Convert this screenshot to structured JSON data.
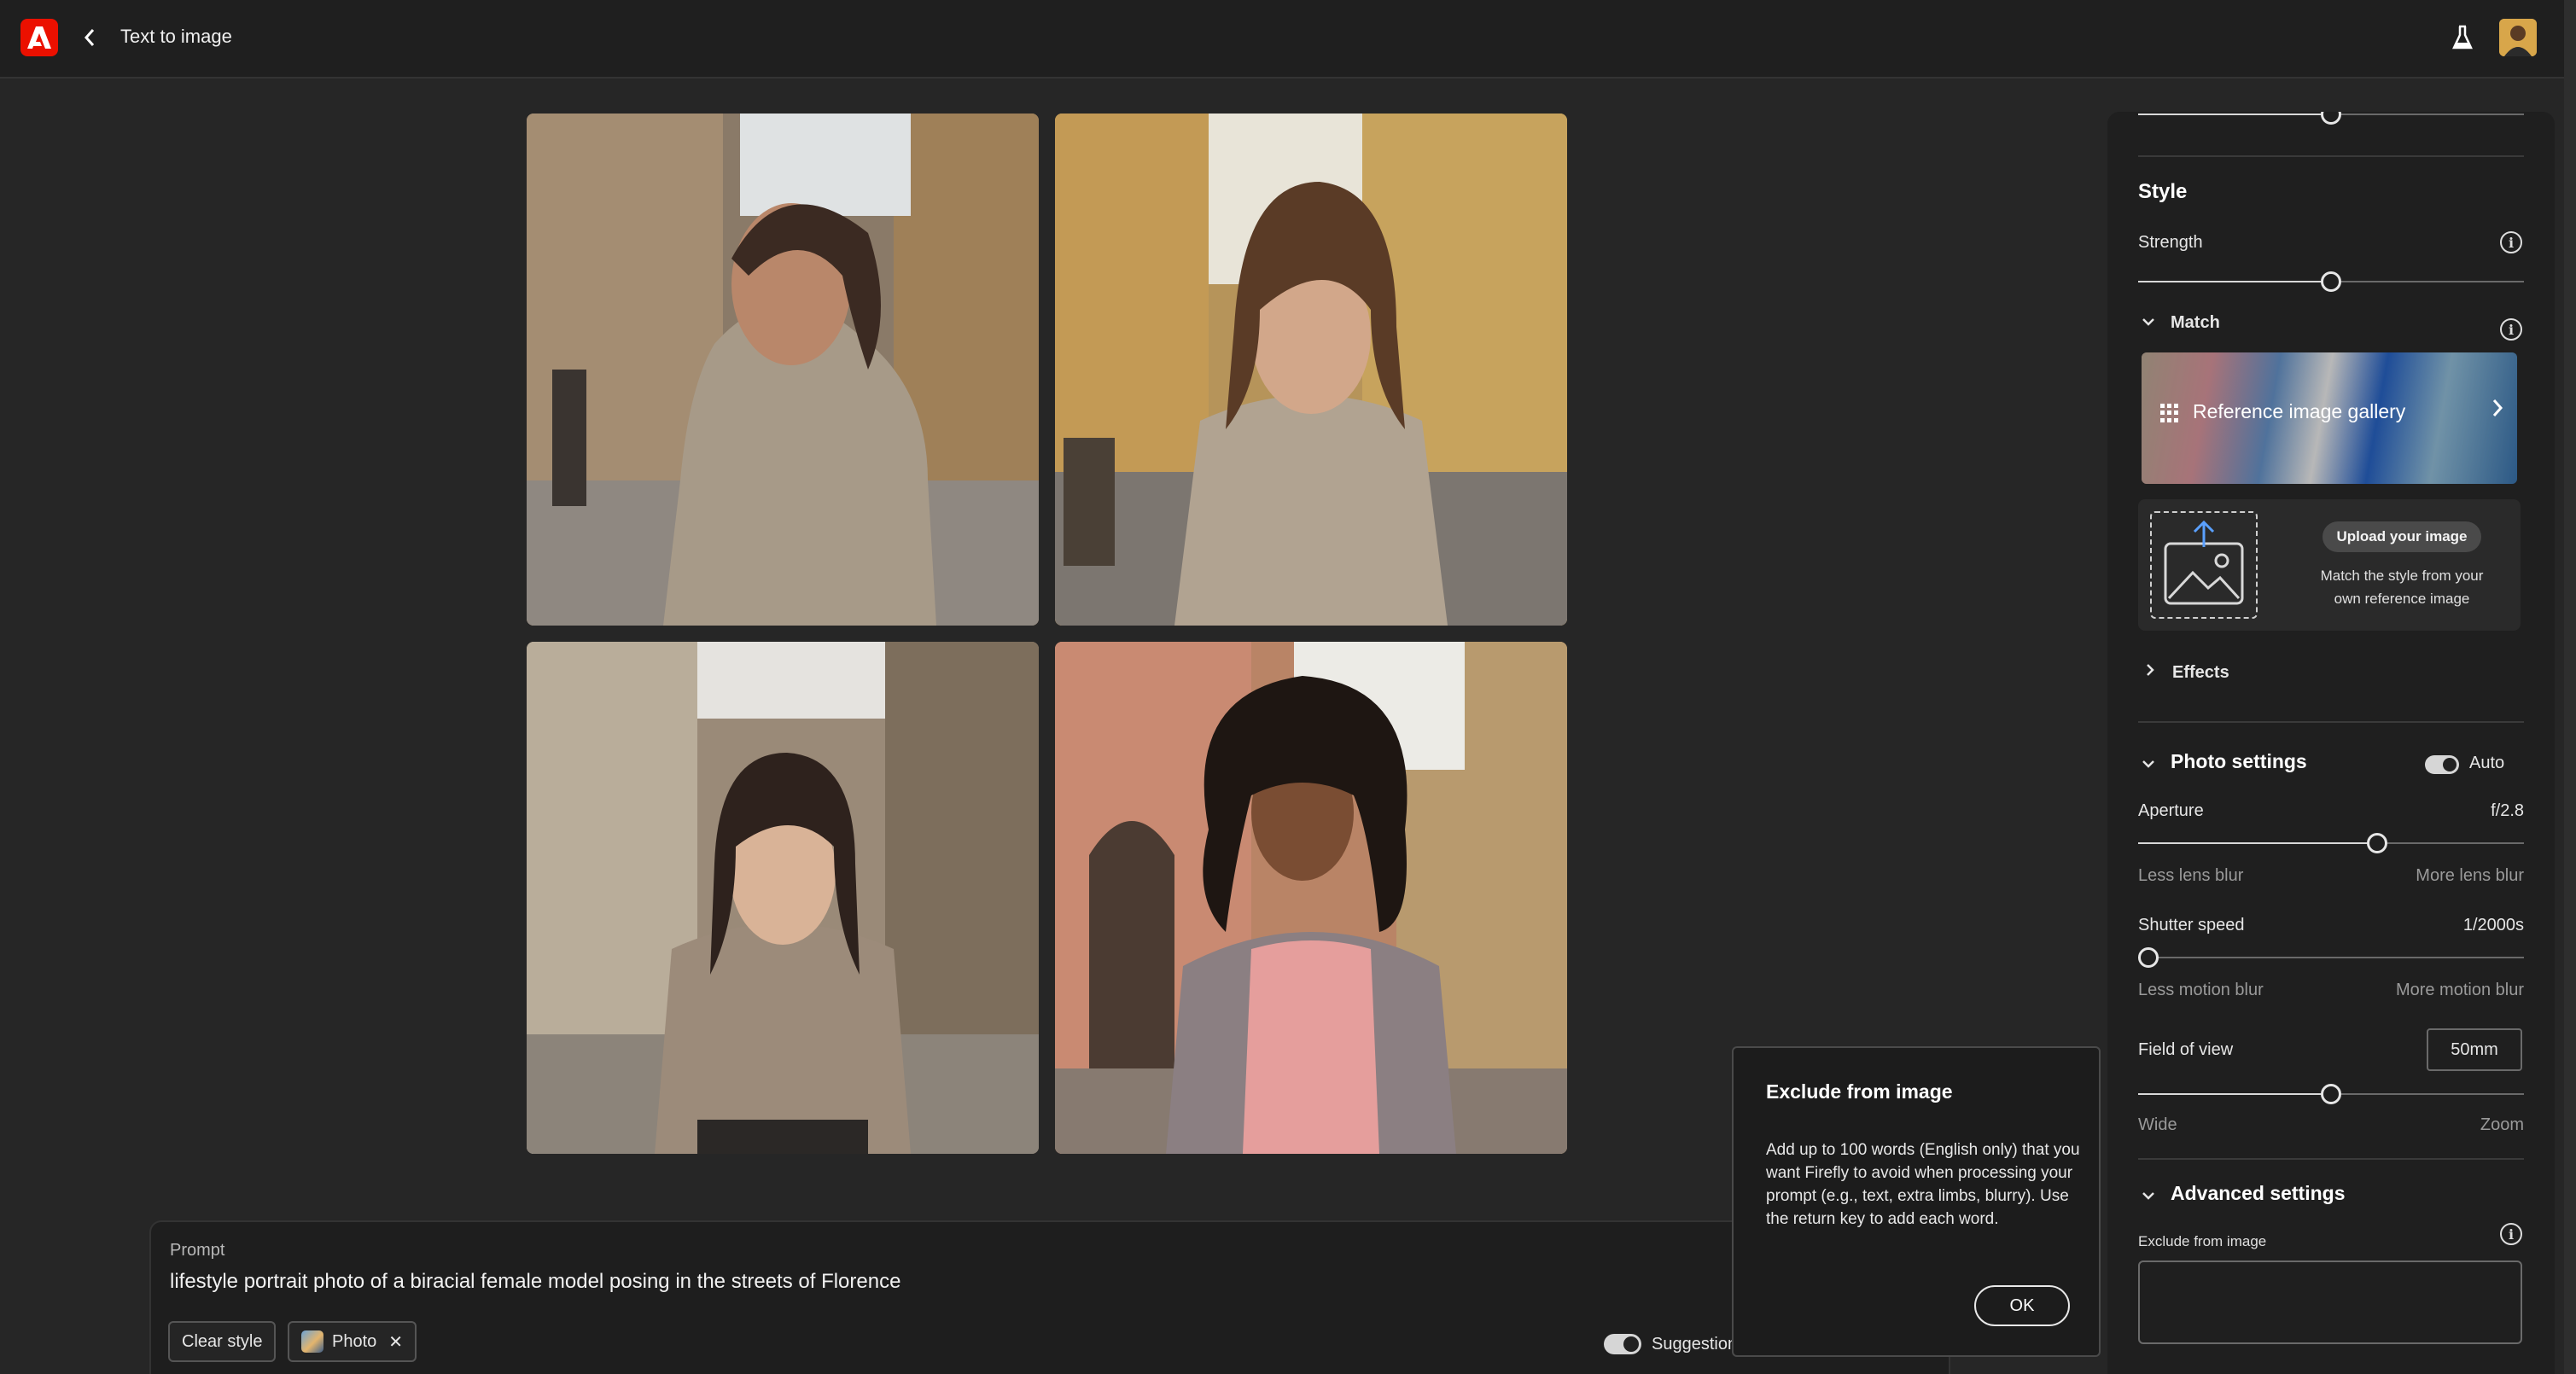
{
  "topbar": {
    "title": "Text to image"
  },
  "gallery_images": [
    {
      "name": "result-image-1"
    },
    {
      "name": "result-image-2"
    },
    {
      "name": "result-image-3"
    },
    {
      "name": "result-image-4"
    }
  ],
  "prompt": {
    "label": "Prompt",
    "text": "lifestyle portrait photo of a biracial female model posing in the streets of Florence",
    "clear_style": "Clear style",
    "photo_chip": "Photo",
    "suggestions_label": "Suggestion"
  },
  "popover": {
    "title": "Exclude from image",
    "body": "Add up to 100 words (English only) that you want Firefly to avoid when processing your prompt (e.g., text, extra limbs, blurry). Use the return key to add each word.",
    "ok": "OK"
  },
  "panel": {
    "style_heading": "Style",
    "strength_label": "Strength",
    "strength_value": 0.5,
    "match_label": "Match",
    "reference_gallery": "Reference image gallery",
    "upload_button": "Upload your image",
    "upload_desc": "Match the style from your own reference image",
    "effects_label": "Effects",
    "photo_settings_label": "Photo settings",
    "auto_label": "Auto",
    "aperture_label": "Aperture",
    "aperture_value": "f/2.8",
    "aperture_slider": 0.62,
    "less_lens_blur": "Less lens blur",
    "more_lens_blur": "More lens blur",
    "shutter_label": "Shutter speed",
    "shutter_value": "1/2000s",
    "shutter_slider": 0.0,
    "less_motion_blur": "Less motion blur",
    "more_motion_blur": "More motion blur",
    "fov_label": "Field of view",
    "fov_value": "50mm",
    "fov_slider": 0.5,
    "wide_label": "Wide",
    "zoom_label": "Zoom",
    "advanced_label": "Advanced settings",
    "exclude_label": "Exclude from image"
  },
  "colors": {
    "accent": "#eb1000",
    "panel": "#1f1f1f",
    "background": "#262626"
  }
}
